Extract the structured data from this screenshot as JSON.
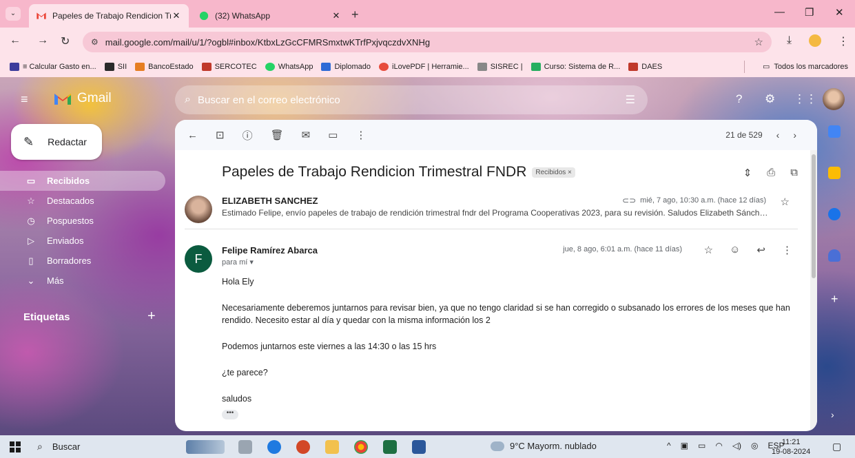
{
  "browser": {
    "tabs": [
      {
        "title": "Papeles de Trabajo Rendicion Tr",
        "close": "✕",
        "active": true
      },
      {
        "title": "(32) WhatsApp",
        "close": "✕",
        "active": false
      }
    ],
    "new_tab": "+",
    "url": "mail.google.com/mail/u/1/?ogbl#inbox/KtbxLzGcCFMRSmxtwKTrfPxjvqczdvXNHg",
    "bookmarks": [
      {
        "label": "≡ Calcular Gasto en...",
        "color": "#3c3c9c"
      },
      {
        "label": "SII",
        "color": "#2a2a2a"
      },
      {
        "label": "BancoEstado",
        "color": "#e67e22"
      },
      {
        "label": "SERCOTEC",
        "color": "#c0392b"
      },
      {
        "label": "WhatsApp",
        "color": "#25d366"
      },
      {
        "label": "Diplomado",
        "color": "#2f6bd6"
      },
      {
        "label": "iLovePDF | Herramie...",
        "color": "#e74c3c"
      },
      {
        "label": "SISREC |",
        "color": "#888888"
      },
      {
        "label": "Curso: Sistema de R...",
        "color": "#27ae60"
      },
      {
        "label": "DAES",
        "color": "#c0392b"
      }
    ],
    "all_bookmarks": "Todos los marcadores"
  },
  "gmail": {
    "logo_text": "Gmail",
    "search_placeholder": "Buscar en el correo electrónico",
    "compose_label": "Redactar",
    "nav": [
      {
        "label": "Recibidos",
        "icon": "inbox-icon",
        "glyph": "▭",
        "active": true
      },
      {
        "label": "Destacados",
        "icon": "star-icon",
        "glyph": "☆",
        "active": false
      },
      {
        "label": "Pospuestos",
        "icon": "clock-icon",
        "glyph": "◷",
        "active": false
      },
      {
        "label": "Enviados",
        "icon": "send-icon",
        "glyph": "▷",
        "active": false
      },
      {
        "label": "Borradores",
        "icon": "draft-icon",
        "glyph": "▯",
        "active": false
      },
      {
        "label": "Más",
        "icon": "chevron-down-icon",
        "glyph": "⌄",
        "active": false
      }
    ],
    "labels_heading": "Etiquetas",
    "labels_add": "+"
  },
  "thread": {
    "pager": "21 de 529",
    "subject": "Papeles de Trabajo Rendicion Trimestral FNDR",
    "label_chip": "Recibidos ×",
    "messages": [
      {
        "sender": "ELIZABETH SANCHEZ",
        "date": "mié, 7 ago, 10:30 a.m. (hace 12 días)",
        "snippet": "Estimado Felipe, envío papeles de trabajo de rendición trimestral fndr del Programa Cooperativas 2023, para su revisión. Saludos Elizabeth Sánch…"
      },
      {
        "sender": "Felipe Ramírez Abarca",
        "avatar_letter": "F",
        "to": "para mí ▾",
        "date": "jue, 8 ago, 6:01 a.m. (hace 11 días)",
        "body": [
          "Hola Ely",
          "Necesariamente deberemos juntarnos para revisar bien, ya que no tengo claridad si se han corregido o subsanado los errores de los meses que han rendido. Necesito estar al día y quedar con la misma información los 2",
          "Podemos juntarnos este viernes a las 14:30 o las 15 hrs",
          "¿te parece?",
          "saludos"
        ]
      }
    ],
    "more": "•••"
  },
  "taskbar": {
    "search_label": "Buscar",
    "weather": "9°C  Mayorm. nublado",
    "lang": "ESP",
    "time": "11:21",
    "date": "19-08-2024"
  },
  "colors": {
    "gmail_red": "#ea4335",
    "compose_bg": "#ffffff",
    "avatar_green": "#0b5b3f"
  }
}
